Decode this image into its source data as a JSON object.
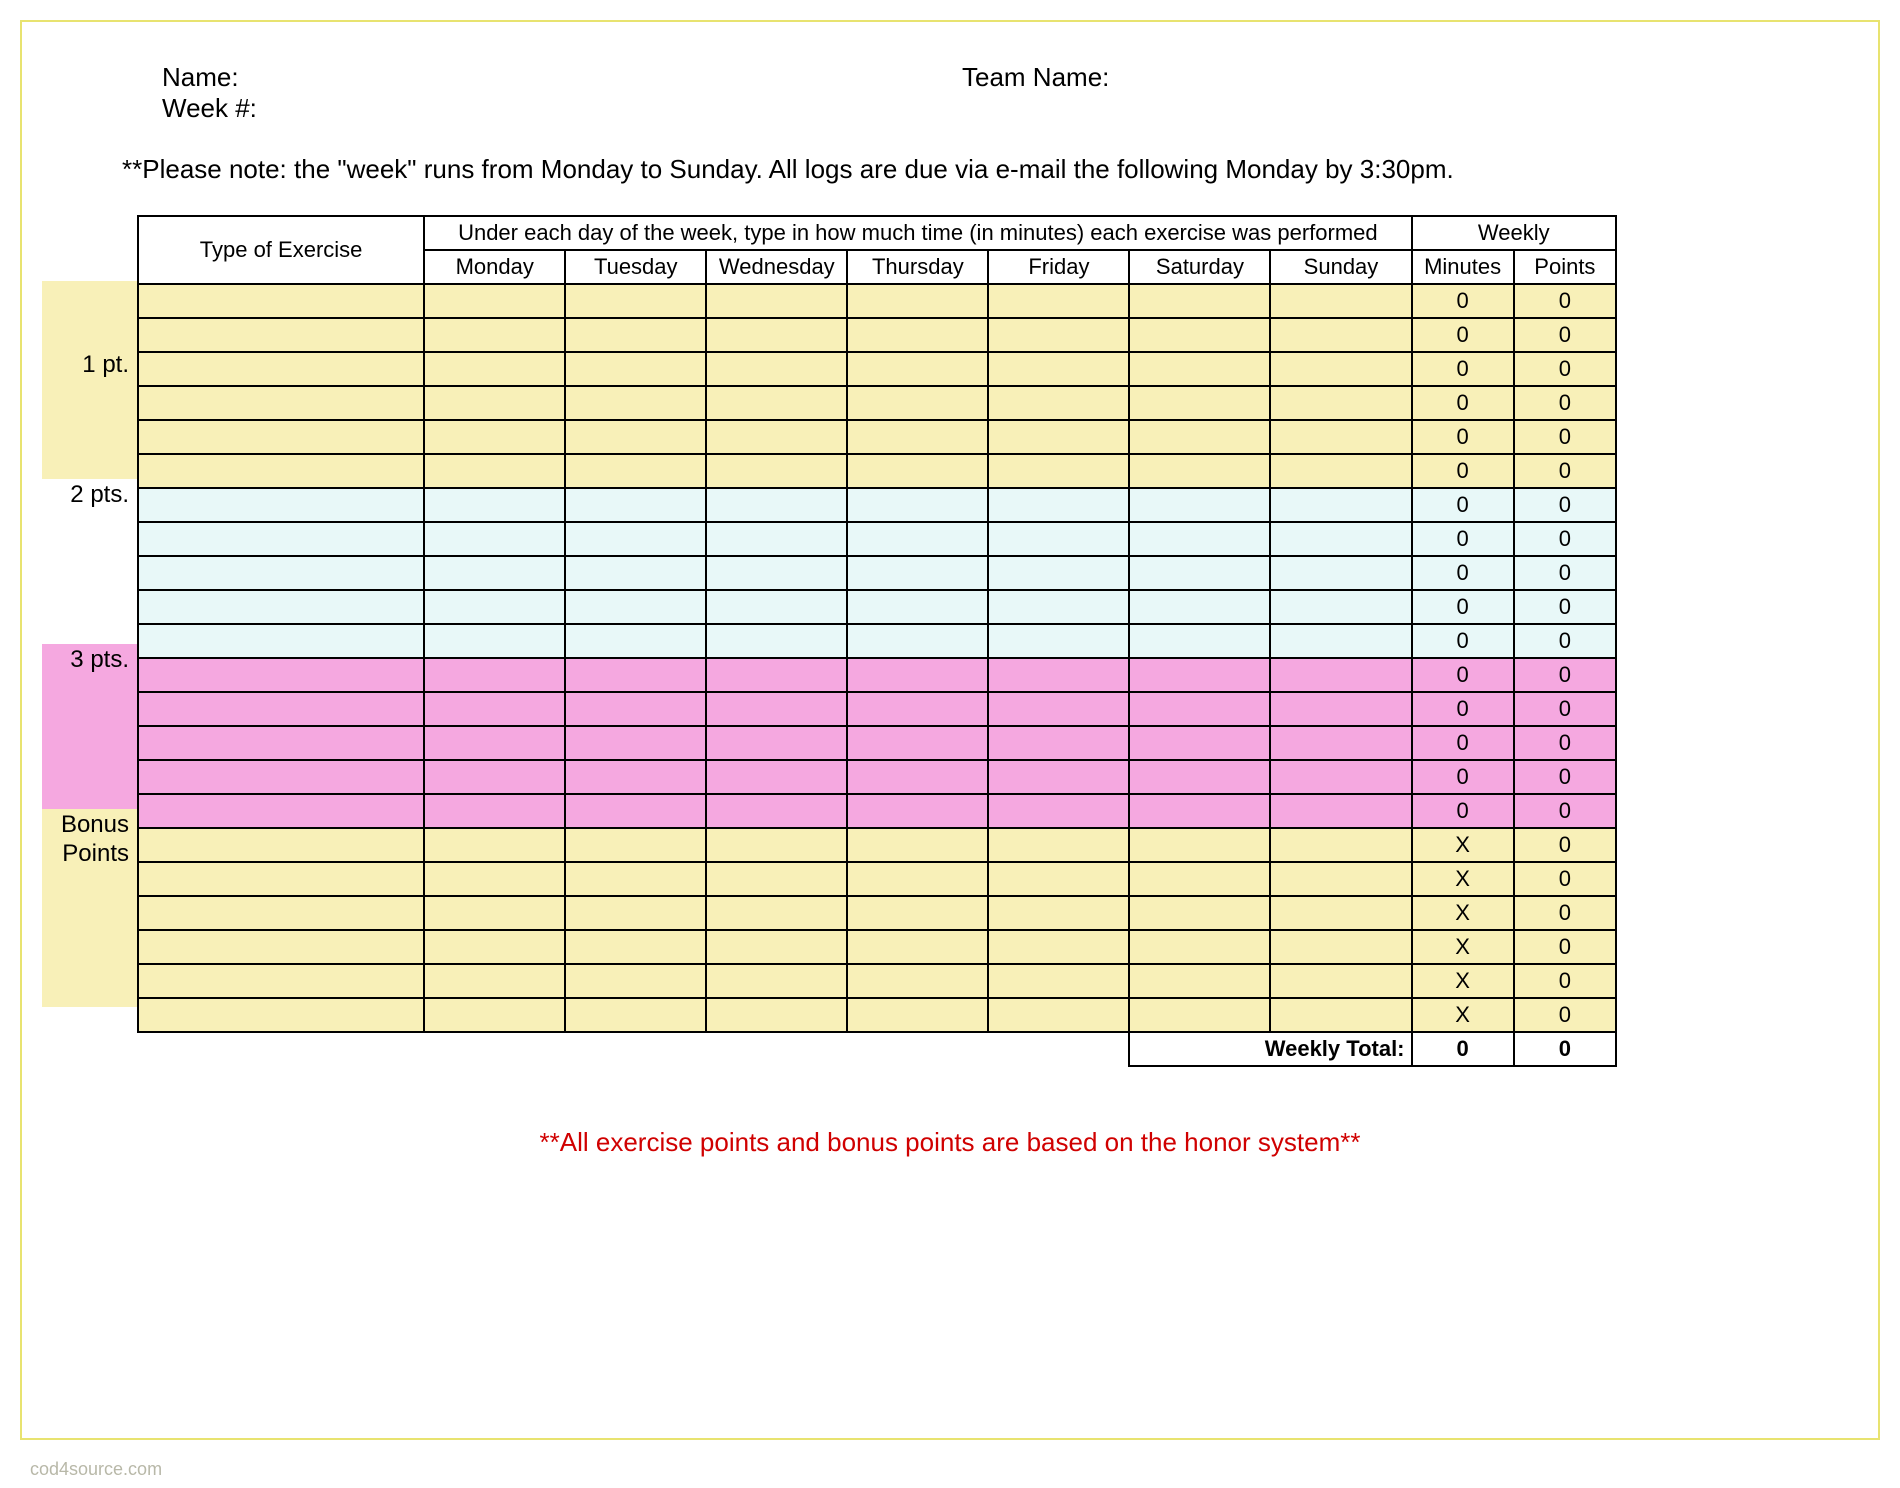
{
  "header": {
    "name_label": "Name:",
    "team_label": "Team Name:",
    "week_label": "Week #:"
  },
  "note": "**Please note: the \"week\" runs from Monday to Sunday.  All logs are due via e-mail the following Monday by 3:30pm.",
  "table": {
    "exercise_header": "Type of Exercise",
    "days_caption": "Under each day of the week, type in how much time (in minutes) each exercise was performed",
    "weekly_header": "Weekly",
    "days": [
      "Monday",
      "Tuesday",
      "Wednesday",
      "Thursday",
      "Friday",
      "Saturday",
      "Sunday"
    ],
    "weekly_cols": [
      "Minutes",
      "Points"
    ],
    "side_labels": {
      "s1": "1 pt.",
      "s2": "2 pts.",
      "s3": "3 pts.",
      "bonus_l1": "Bonus",
      "bonus_l2": "Points"
    },
    "sections": {
      "s1": {
        "rows": 6,
        "minutes": "0",
        "points": "0"
      },
      "s2": {
        "rows": 5,
        "minutes": "0",
        "points": "0"
      },
      "s3": {
        "rows": 5,
        "minutes": "0",
        "points": "0"
      },
      "bonus": {
        "rows": 6,
        "minutes": "X",
        "points": "0"
      }
    },
    "totals": {
      "label": "Weekly Total:",
      "minutes": "0",
      "points": "0"
    }
  },
  "footer": "**All exercise points and bonus points are based on the honor system**",
  "watermark": "cod4source.com"
}
